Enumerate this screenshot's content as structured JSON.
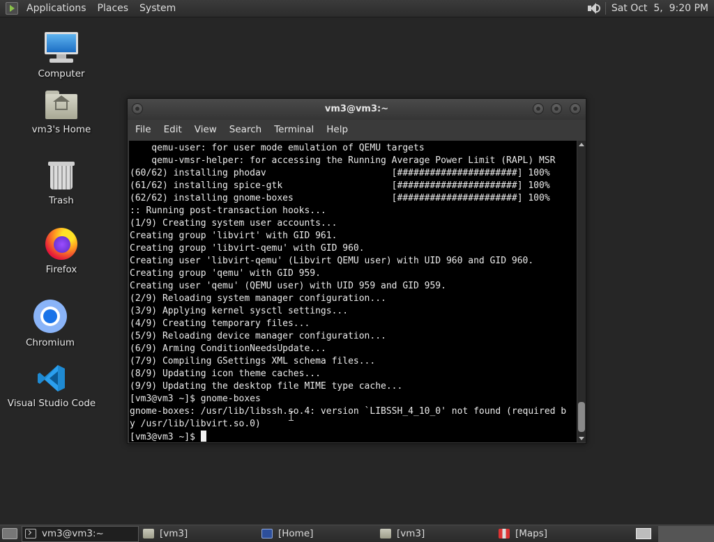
{
  "top_panel": {
    "menus": [
      "Applications",
      "Places",
      "System"
    ],
    "clock": "Sat Oct  5,  9:20 PM"
  },
  "desktop": {
    "icons": [
      {
        "label": "Computer",
        "icon": "computer-icon"
      },
      {
        "label": "vm3's Home",
        "icon": "home-folder-icon"
      },
      {
        "label": "Trash",
        "icon": "trash-icon"
      },
      {
        "label": "Firefox",
        "icon": "firefox-icon"
      },
      {
        "label": "Chromium",
        "icon": "chromium-icon"
      },
      {
        "label": "Visual Studio Code",
        "icon": "vscode-icon"
      }
    ]
  },
  "terminal": {
    "title": "vm3@vm3:~",
    "menu": [
      "File",
      "Edit",
      "View",
      "Search",
      "Terminal",
      "Help"
    ],
    "lines": [
      "    qemu-user: for user mode emulation of QEMU targets",
      "    qemu-vmsr-helper: for accessing the Running Average Power Limit (RAPL) MSR",
      "(60/62) installing phodav                       [######################] 100%",
      "(61/62) installing spice-gtk                    [######################] 100%",
      "(62/62) installing gnome-boxes                  [######################] 100%",
      ":: Running post-transaction hooks...",
      "(1/9) Creating system user accounts...",
      "Creating group 'libvirt' with GID 961.",
      "Creating group 'libvirt-qemu' with GID 960.",
      "Creating user 'libvirt-qemu' (Libvirt QEMU user) with UID 960 and GID 960.",
      "Creating group 'qemu' with GID 959.",
      "Creating user 'qemu' (QEMU user) with UID 959 and GID 959.",
      "(2/9) Reloading system manager configuration...",
      "(3/9) Applying kernel sysctl settings...",
      "(4/9) Creating temporary files...",
      "(5/9) Reloading device manager configuration...",
      "(6/9) Arming ConditionNeedsUpdate...",
      "(7/9) Compiling GSettings XML schema files...",
      "(8/9) Updating icon theme caches...",
      "(9/9) Updating the desktop file MIME type cache...",
      "[vm3@vm3 ~]$ gnome-boxes",
      "gnome-boxes: /usr/lib/libssh.so.4: version `LIBSSH_4_10_0' not found (required b",
      "y /usr/lib/libvirt.so.0)"
    ],
    "prompt": "[vm3@vm3 ~]$ "
  },
  "taskbar": {
    "tasks": [
      {
        "label": "vm3@vm3:~",
        "icon": "terminal-icon",
        "active": true
      },
      {
        "label": "[vm3]",
        "icon": "folder-icon",
        "active": false
      },
      {
        "label": "[Home]",
        "icon": "book-icon",
        "active": false
      },
      {
        "label": "[vm3]",
        "icon": "folder-icon",
        "active": false
      },
      {
        "label": "[Maps]",
        "icon": "maps-icon",
        "active": false
      }
    ]
  }
}
